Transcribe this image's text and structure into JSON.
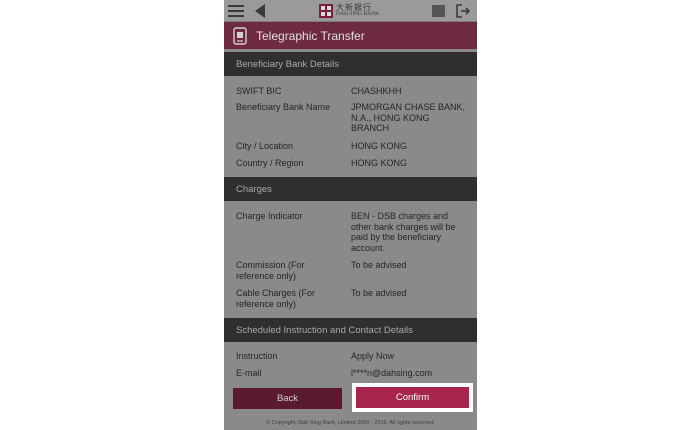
{
  "brand": {
    "name_cn": "大新銀行",
    "name_en": "DAH SING BANK",
    "accent": "#a8254e"
  },
  "header": {
    "title": "Telegraphic Transfer"
  },
  "sections": [
    {
      "title": "Beneficiary Bank Details",
      "rows": [
        {
          "label": "SWIFT BIC",
          "value": "CHASHKHH"
        },
        {
          "label": "Beneficiary Bank Name",
          "value": "JPMORGAN CHASE BANK, N.A., HONG KONG BRANCH"
        },
        {
          "label": "City / Location",
          "value": "HONG KONG"
        },
        {
          "label": "Country / Region",
          "value": "HONG KONG"
        }
      ]
    },
    {
      "title": "Charges",
      "rows": [
        {
          "label": "Charge Indicator",
          "value": "BEN - DSB charges and other bank charges will be paid by the beneficiary account."
        },
        {
          "label": "Commission (For reference only)",
          "value": "To be advised"
        },
        {
          "label": "Cable Charges (For reference only)",
          "value": "To be advised"
        }
      ]
    },
    {
      "title": "Scheduled Instruction and Contact Details",
      "rows": [
        {
          "label": "Instruction",
          "value": "Apply Now"
        },
        {
          "label": "E-mail",
          "value": "l****n@dahsing.com"
        }
      ]
    }
  ],
  "actions": {
    "back_label": "Back",
    "confirm_label": "Confirm"
  },
  "footer": {
    "copyright": "© Copyright. Dah Sing Bank, Limited 2000 - 2019. All rights reserved."
  },
  "icons": {
    "menu": "hamburger-icon",
    "back": "back-arrow-icon",
    "flag": "flag-icon",
    "logout": "logout-icon",
    "transfer": "transfer-doc-icon"
  }
}
